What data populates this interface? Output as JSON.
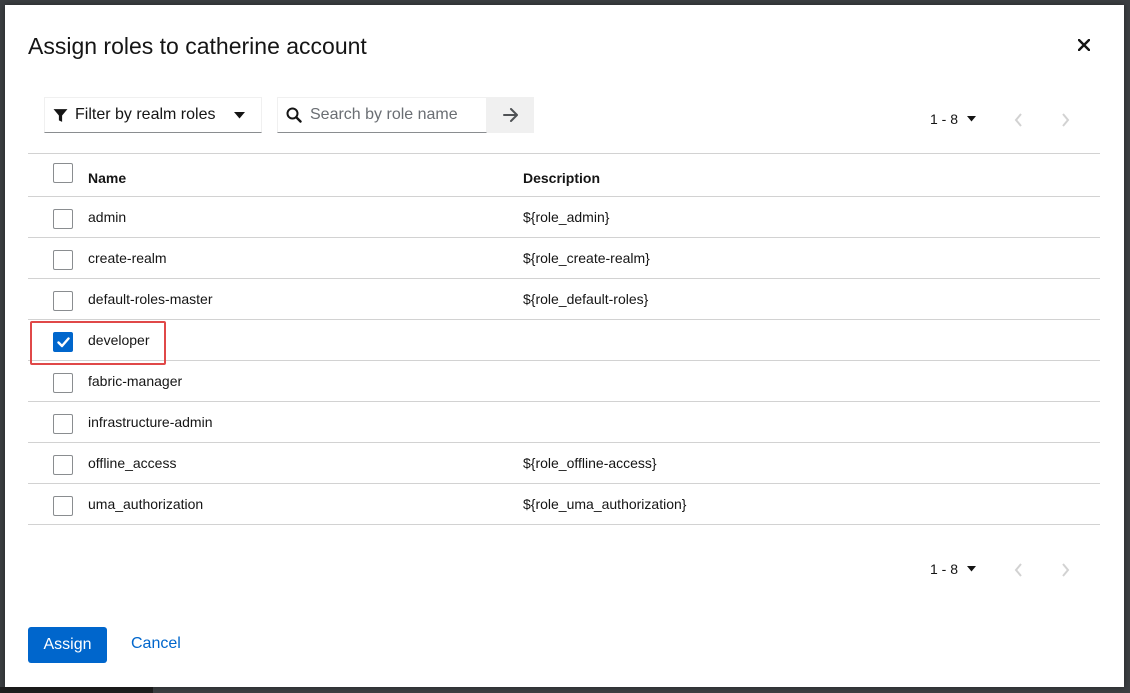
{
  "dialog": {
    "title": "Assign roles to catherine account"
  },
  "toolbar": {
    "filter_label": "Filter by realm roles",
    "search_placeholder": "Search by role name"
  },
  "pagination_top": {
    "range": "1 - 8"
  },
  "pagination_bottom": {
    "range": "1 - 8"
  },
  "table": {
    "headers": {
      "name": "Name",
      "description": "Description"
    },
    "rows": [
      {
        "name": "admin",
        "description": "${role_admin}",
        "checked": false
      },
      {
        "name": "create-realm",
        "description": "${role_create-realm}",
        "checked": false
      },
      {
        "name": "default-roles-master",
        "description": "${role_default-roles}",
        "checked": false
      },
      {
        "name": "developer",
        "description": "",
        "checked": true
      },
      {
        "name": "fabric-manager",
        "description": "",
        "checked": false
      },
      {
        "name": "infrastructure-admin",
        "description": "",
        "checked": false
      },
      {
        "name": "offline_access",
        "description": "${role_offline-access}",
        "checked": false
      },
      {
        "name": "uma_authorization",
        "description": "${role_uma_authorization}",
        "checked": false
      }
    ]
  },
  "footer": {
    "assign_label": "Assign",
    "cancel_label": "Cancel"
  },
  "colors": {
    "primary": "#0066cc",
    "highlight": "#e04848"
  }
}
